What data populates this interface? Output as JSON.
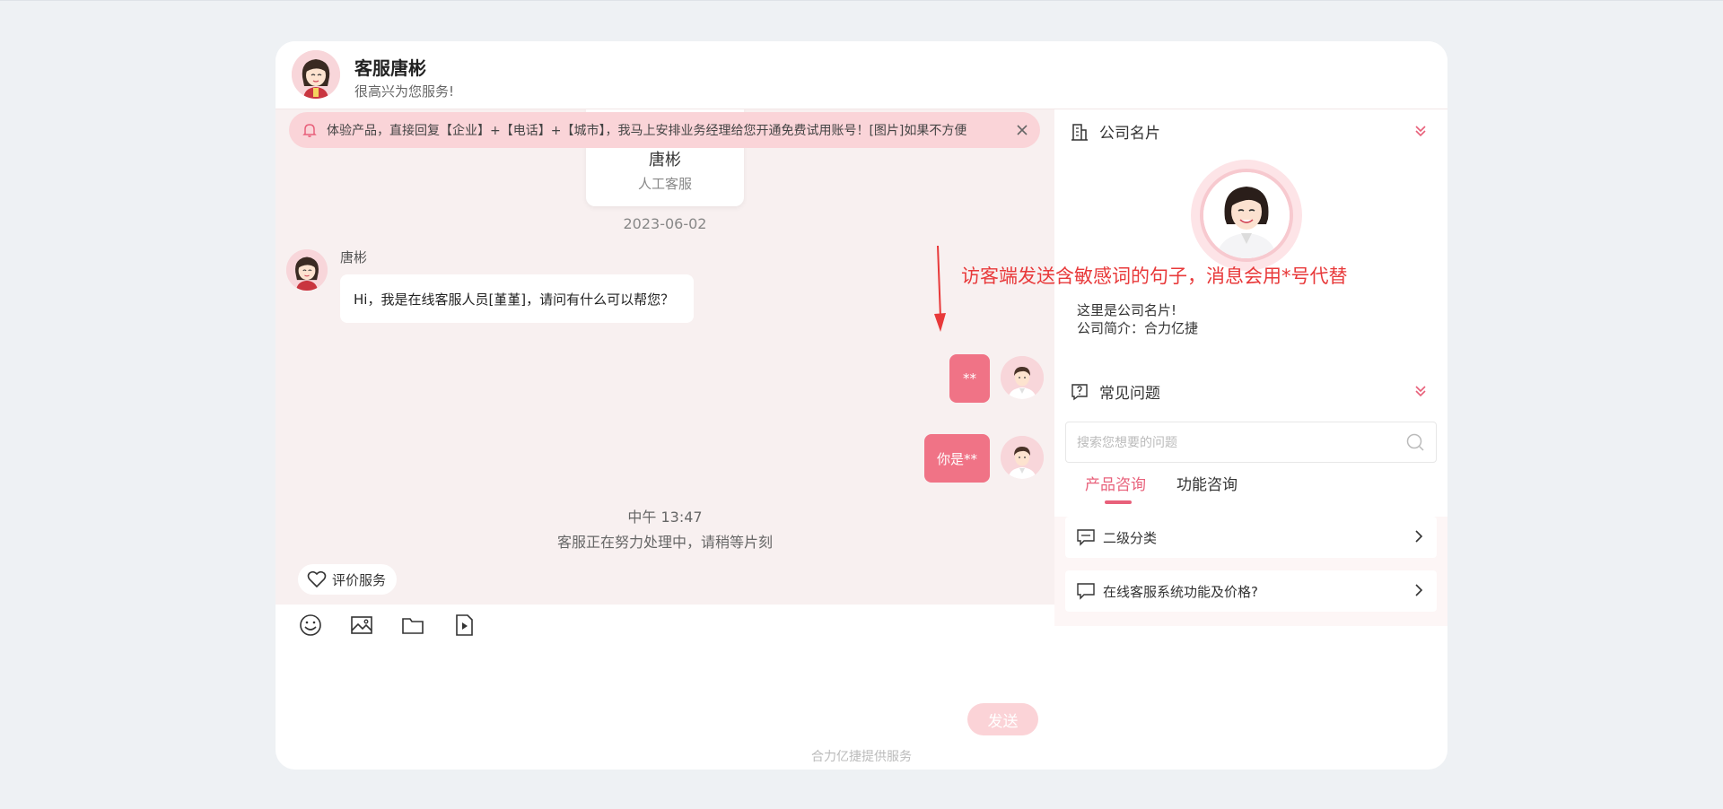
{
  "header": {
    "agent_title": "客服唐彬",
    "subtitle": "很高兴为您服务!"
  },
  "notice": {
    "text": "体验产品，直接回复【企业】+【电话】+【城市】，我马上安排业务经理给您开通免费试用账号！[图片]如果不方便"
  },
  "agent_card": {
    "name": "唐彬",
    "role": "人工客服"
  },
  "chat": {
    "date": "2023-06-02",
    "messages": [
      {
        "from": "agent",
        "name": "唐彬",
        "text": "Hi，我是在线客服人员[堇堇]，请问有什么可以帮您？"
      },
      {
        "from": "visitor",
        "text": "**"
      },
      {
        "from": "visitor",
        "text": "你是**"
      }
    ],
    "time": "中午 13:47",
    "status": "客服正在努力处理中，请稍等片刻",
    "rate_label": "评价服务"
  },
  "annotation": {
    "text": "访客端发送含敏感词的句子，消息会用*号代替",
    "color": "#e8393a"
  },
  "composer": {
    "tools": [
      "emoji-icon",
      "image-icon",
      "folder-icon",
      "video-file-icon"
    ],
    "send_label": "发送"
  },
  "footer": {
    "powered_by": "合力亿捷提供服务"
  },
  "panel": {
    "company": {
      "title": "公司名片",
      "line1": "这里是公司名片!",
      "line2": "公司简介：合力亿捷"
    },
    "faq": {
      "title": "常见问题",
      "search_placeholder": "搜索您想要的问题",
      "tabs": [
        {
          "label": "产品咨询",
          "active": true
        },
        {
          "label": "功能咨询",
          "active": false
        }
      ],
      "items": [
        {
          "label": "二级分类"
        },
        {
          "label": "在线客服系统功能及价格?"
        }
      ]
    }
  },
  "colors": {
    "accent": "#f07386",
    "tab_active": "#e8607a",
    "chat_bg": "#f8f0f0",
    "notice_bg": "#fad4d8"
  }
}
